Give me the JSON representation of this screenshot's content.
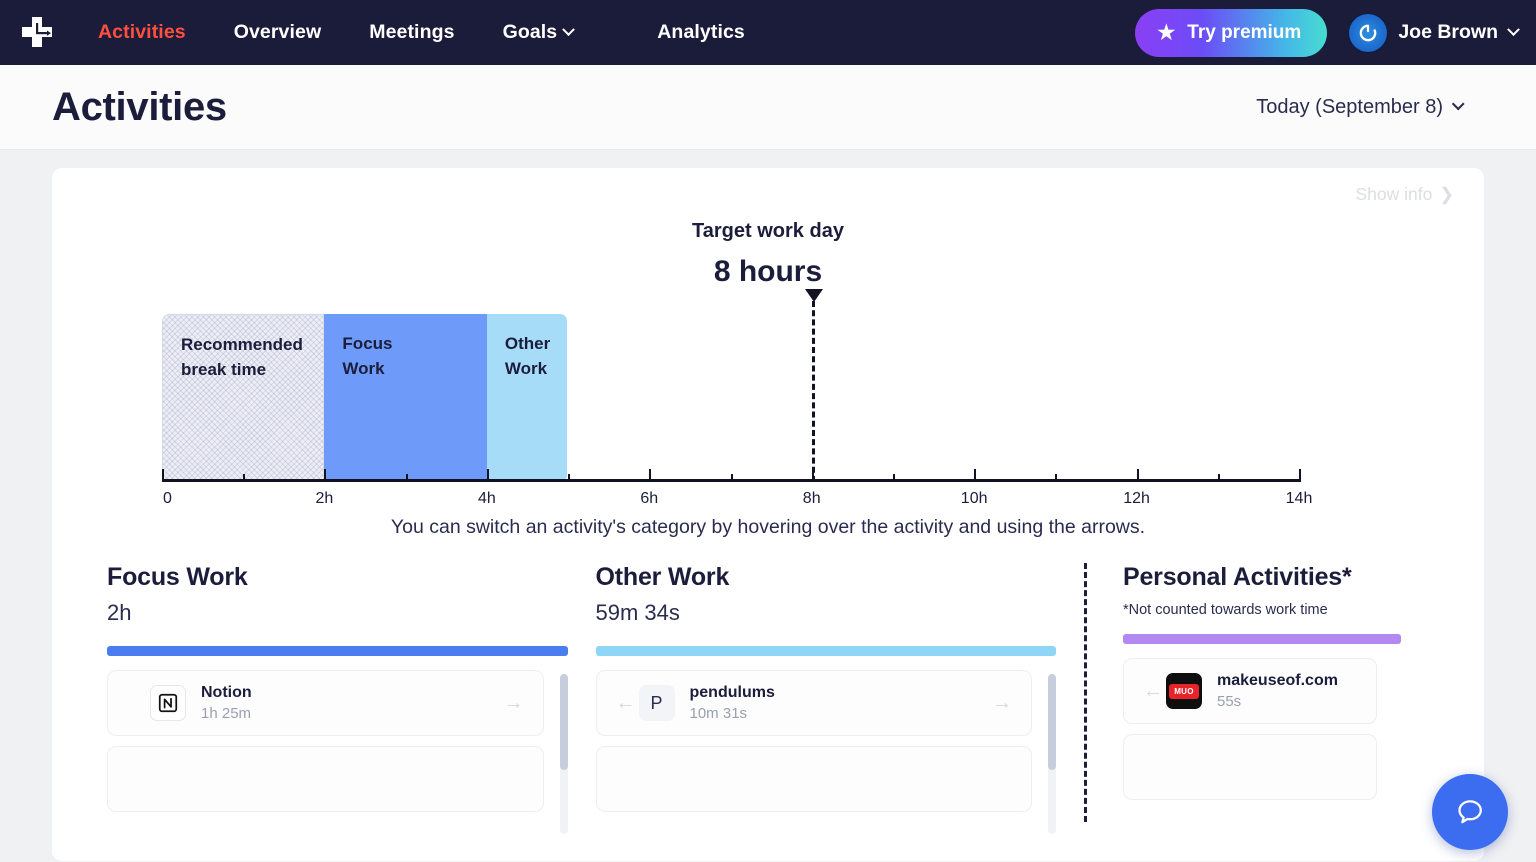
{
  "nav": {
    "logo_icon": "clock-cross-logo-icon",
    "links": [
      {
        "label": "Activities",
        "active": true
      },
      {
        "label": "Overview",
        "active": false
      },
      {
        "label": "Meetings",
        "active": false
      },
      {
        "label": "Goals",
        "active": false,
        "has_caret": true
      },
      {
        "label": "Analytics",
        "active": false
      }
    ],
    "premium_label": "Try premium",
    "premium_icon": "star-icon",
    "user_name": "Joe Brown",
    "avatar_icon": "power-refresh-avatar-icon",
    "user_caret_icon": "chevron-down-icon"
  },
  "header": {
    "title": "Activities",
    "date_label": "Today (September 8)",
    "date_caret_icon": "chevron-down-icon"
  },
  "card": {
    "show_info_label": "Show info",
    "show_info_icon": "chevron-right-icon"
  },
  "target": {
    "label": "Target work day",
    "value": "8 hours",
    "marker_icon": "triangle-down-marker-icon"
  },
  "hint": "You can switch an activity's category by hovering over the activity and using the arrows.",
  "chart_data": {
    "type": "bar",
    "orientation": "horizontal-stacked",
    "title": "Target work day",
    "xlabel": "",
    "ylabel": "",
    "xlim": [
      0,
      14
    ],
    "xunit": "h",
    "tick_values": [
      0,
      1,
      2,
      3,
      4,
      5,
      6,
      7,
      8,
      9,
      10,
      11,
      12,
      13,
      14
    ],
    "tick_labels": [
      "0",
      "",
      "2h",
      "",
      "4h",
      "",
      "6h",
      "",
      "8h",
      "",
      "10h",
      "",
      "12h",
      "",
      "14h"
    ],
    "target_marker": {
      "value": 8,
      "label": "Target work day",
      "value_label": "8 hours"
    },
    "grid": false,
    "legend": "in-bar",
    "segments": [
      {
        "name": "Recommended break time",
        "label": "Recommended\nbreak time",
        "start": 0,
        "end": 2,
        "hours": 2,
        "color": "#edeef5",
        "pattern": "cross-hatch"
      },
      {
        "name": "Focus Work",
        "label": "Focus\nWork",
        "start": 2,
        "end": 4,
        "hours": 2,
        "color": "#6e9bfa"
      },
      {
        "name": "Other Work",
        "label": "Other\nWork",
        "start": 4,
        "end": 4.993,
        "hours": 0.993,
        "color": "#a6dcf8"
      }
    ]
  },
  "columns": [
    {
      "key": "focus",
      "title": "Focus Work",
      "total": "2h",
      "bar_color": "#4a7ef0",
      "note": null,
      "personal": false,
      "items": [
        {
          "name": "Notion",
          "time": "1h 25m",
          "icon": "notion-icon",
          "icon_letter": "N",
          "has_left_arrow": false,
          "has_right_arrow": true
        }
      ]
    },
    {
      "key": "other",
      "title": "Other Work",
      "total": "59m 34s",
      "bar_color": "#8fd5f5",
      "note": null,
      "personal": false,
      "items": [
        {
          "name": "pendulums",
          "time": "10m 31s",
          "icon": "letter-avatar-icon",
          "icon_letter": "P",
          "has_left_arrow": true,
          "has_right_arrow": true
        }
      ]
    },
    {
      "key": "personal",
      "title": "Personal Activities*",
      "total": null,
      "bar_color": "#b388f0",
      "note": "*Not counted towards work time",
      "personal": true,
      "items": [
        {
          "name": "makeuseof.com",
          "time": "55s",
          "icon": "muo-icon",
          "icon_letter": "MUO",
          "has_left_arrow": true,
          "has_right_arrow": false
        }
      ]
    }
  ],
  "help": {
    "icon": "chat-bubble-icon",
    "color": "#3c6df0"
  }
}
